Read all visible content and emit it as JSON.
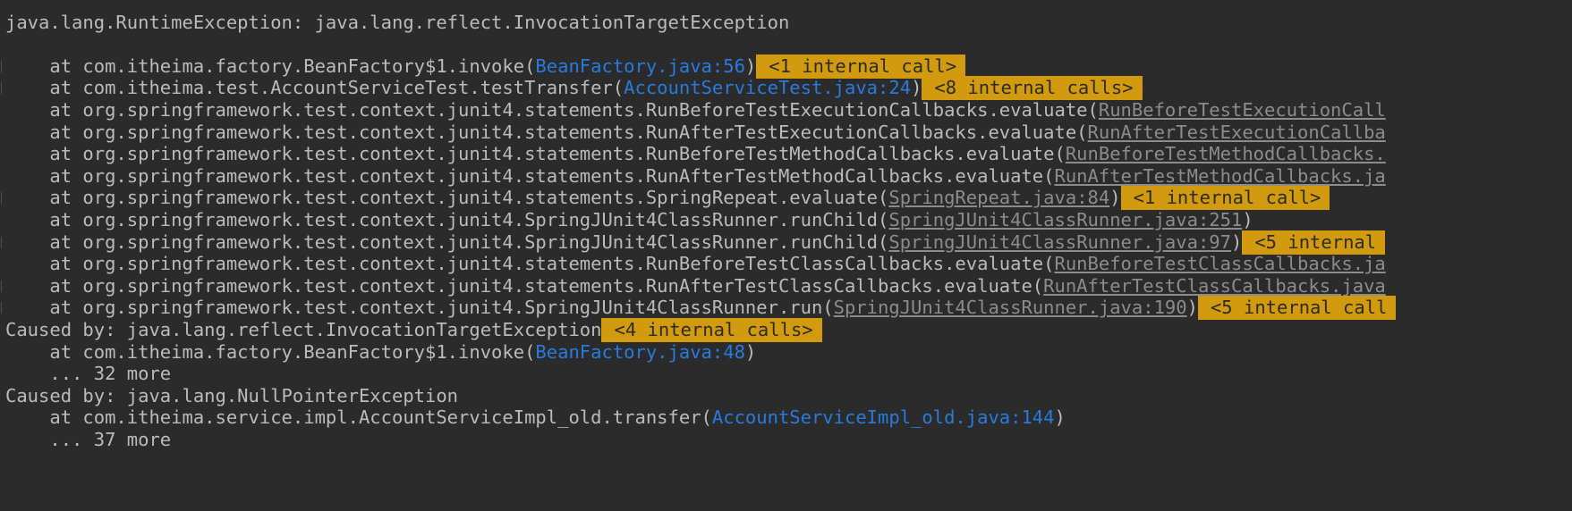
{
  "colors": {
    "background": "#2b2b2b",
    "text": "#bbbbbb",
    "link": "#287bde",
    "link_underlined": "#8c8c8c",
    "badge": "#d19a0f"
  },
  "lines": [
    {
      "pre": "java.lang.RuntimeException: java.lang.reflect.InvocationTargetException",
      "link": "",
      "post": "",
      "badge": "",
      "fold": false
    },
    {
      "pre": "",
      "link": "",
      "post": "",
      "badge": "",
      "fold": false
    },
    {
      "pre": "    at com.itheima.factory.BeanFactory$1.invoke(",
      "link": "BeanFactory.java:56",
      "post": ")",
      "badge": "<1 internal call>",
      "fold": true
    },
    {
      "pre": "    at com.itheima.test.AccountServiceTest.testTransfer(",
      "link": "AccountServiceTest.java:24",
      "post": ")",
      "badge": "<8 internal calls>",
      "fold": true
    },
    {
      "pre": "    at org.springframework.test.context.junit4.statements.RunBeforeTestExecutionCallbacks.evaluate(",
      "link": "RunBeforeTestExecutionCall",
      "post": "",
      "badge": "",
      "fold": false,
      "ul": true
    },
    {
      "pre": "    at org.springframework.test.context.junit4.statements.RunAfterTestExecutionCallbacks.evaluate(",
      "link": "RunAfterTestExecutionCallba",
      "post": "",
      "badge": "",
      "fold": false,
      "ul": true
    },
    {
      "pre": "    at org.springframework.test.context.junit4.statements.RunBeforeTestMethodCallbacks.evaluate(",
      "link": "RunBeforeTestMethodCallbacks.",
      "post": "",
      "badge": "",
      "fold": false,
      "ul": true
    },
    {
      "pre": "    at org.springframework.test.context.junit4.statements.RunAfterTestMethodCallbacks.evaluate(",
      "link": "RunAfterTestMethodCallbacks.ja",
      "post": "",
      "badge": "",
      "fold": false,
      "ul": true
    },
    {
      "pre": "    at org.springframework.test.context.junit4.statements.SpringRepeat.evaluate(",
      "link": "SpringRepeat.java:84",
      "post": ")",
      "badge": "<1 internal call>",
      "fold": true,
      "ul": true
    },
    {
      "pre": "    at org.springframework.test.context.junit4.SpringJUnit4ClassRunner.runChild(",
      "link": "SpringJUnit4ClassRunner.java:251",
      "post": ")",
      "badge": "",
      "fold": false,
      "ul": true
    },
    {
      "pre": "    at org.springframework.test.context.junit4.SpringJUnit4ClassRunner.runChild(",
      "link": "SpringJUnit4ClassRunner.java:97",
      "post": ")",
      "badge": "<5 internal",
      "fold": true,
      "ul": true
    },
    {
      "pre": "    at org.springframework.test.context.junit4.statements.RunBeforeTestClassCallbacks.evaluate(",
      "link": "RunBeforeTestClassCallbacks.ja",
      "post": "",
      "badge": "",
      "fold": false,
      "ul": true
    },
    {
      "pre": "    at org.springframework.test.context.junit4.statements.RunAfterTestClassCallbacks.evaluate(",
      "link": "RunAfterTestClassCallbacks.java",
      "post": "",
      "badge": "",
      "fold": true,
      "ul": true
    },
    {
      "pre": "    at org.springframework.test.context.junit4.SpringJUnit4ClassRunner.run(",
      "link": "SpringJUnit4ClassRunner.java:190",
      "post": ")",
      "badge": "<5 internal call",
      "fold": true,
      "ul": true
    },
    {
      "pre": "Caused by: java.lang.reflect.InvocationTargetException",
      "link": "",
      "post": "",
      "badge": "<4 internal calls>",
      "fold": false
    },
    {
      "pre": "    at com.itheima.factory.BeanFactory$1.invoke(",
      "link": "BeanFactory.java:48",
      "post": ")",
      "badge": "",
      "fold": false
    },
    {
      "pre": "    ... 32 more",
      "link": "",
      "post": "",
      "badge": "",
      "fold": false
    },
    {
      "pre": "Caused by: java.lang.NullPointerException",
      "link": "",
      "post": "",
      "badge": "",
      "fold": false
    },
    {
      "pre": "    at com.itheima.service.impl.AccountServiceImpl_old.transfer(",
      "link": "AccountServiceImpl_old.java:144",
      "post": ")",
      "badge": "",
      "fold": false
    },
    {
      "pre": "    ... 37 more",
      "link": "",
      "post": "",
      "badge": "",
      "fold": false
    }
  ]
}
